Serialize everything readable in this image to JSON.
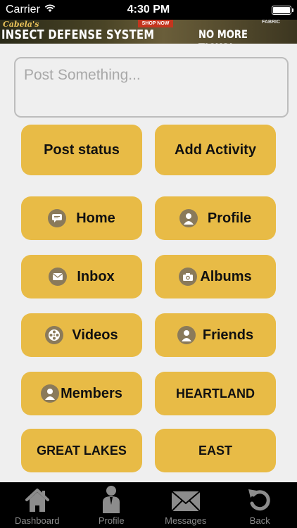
{
  "status_bar": {
    "carrier": "Carrier",
    "time": "4:30 PM"
  },
  "ad": {
    "brand": "Cabela's",
    "title": "INSECT DEFENSE SYSTEM",
    "cta": "SHOP NOW",
    "fabric_label": "FABRIC",
    "right_text": "NO MORE TICKS!"
  },
  "post": {
    "placeholder": "Post Something..."
  },
  "actions": {
    "post_status": "Post status",
    "add_activity": "Add Activity"
  },
  "menu": {
    "home": "Home",
    "profile": "Profile",
    "inbox": "Inbox",
    "albums": "Albums",
    "videos": "Videos",
    "friends": "Friends",
    "members": "Members",
    "heartland": "HEARTLAND",
    "great_lakes": "GREAT LAKES",
    "east": "EAST"
  },
  "tabs": [
    {
      "label": "Dashboard",
      "icon": "house-icon"
    },
    {
      "label": "Profile",
      "icon": "person-icon"
    },
    {
      "label": "Messages",
      "icon": "envelope-icon"
    },
    {
      "label": "Back",
      "icon": "back-arrow-icon"
    }
  ],
  "colors": {
    "button": "#e8bb46",
    "icon_circle": "#8a7a5a",
    "tab_bar": "#000000",
    "tab_text": "#8c8c8c",
    "background": "#efefef"
  }
}
